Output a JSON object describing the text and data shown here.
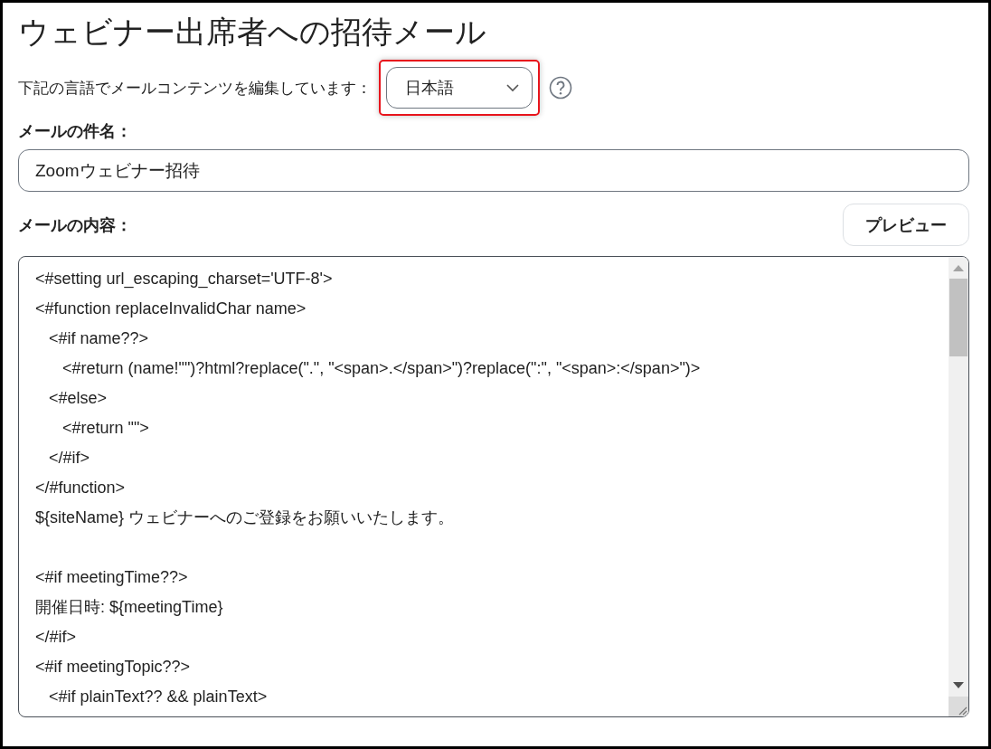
{
  "title": "ウェビナー出席者への招待メール",
  "language": {
    "label": "下記の言語でメールコンテンツを編集しています：",
    "value": "日本語",
    "highlighted": true
  },
  "subject": {
    "label": "メールの件名：",
    "value": "Zoomウェビナー招待"
  },
  "content": {
    "label": "メールの内容：",
    "preview_button": "プレビュー",
    "lines": [
      {
        "text": "<#setting url_escaping_charset='UTF-8'>"
      },
      {
        "text": "<#function replaceInvalidChar name>"
      },
      {
        "text": "   <#if name??>"
      },
      {
        "text": "      <#return (name!\"\")?html?replace(\".\", \"<span>.</span>\")?replace(\":\", \"<span>:</span>\")>"
      },
      {
        "text": "   <#else>"
      },
      {
        "text": "      <#return \"\">"
      },
      {
        "text": "   </#if>"
      },
      {
        "text": "</#function>"
      },
      {
        "text": "${siteName} ウェビナーへのご登録をお願いいたします。"
      },
      {
        "text": "<#if meetingTime??>",
        "blank_line_before": true
      },
      {
        "text": "開催日時: ${meetingTime}"
      },
      {
        "text": "</#if>"
      },
      {
        "text": "<#if meetingTopic??>"
      },
      {
        "text": "   <#if plainText?? && plainText>"
      }
    ]
  }
}
